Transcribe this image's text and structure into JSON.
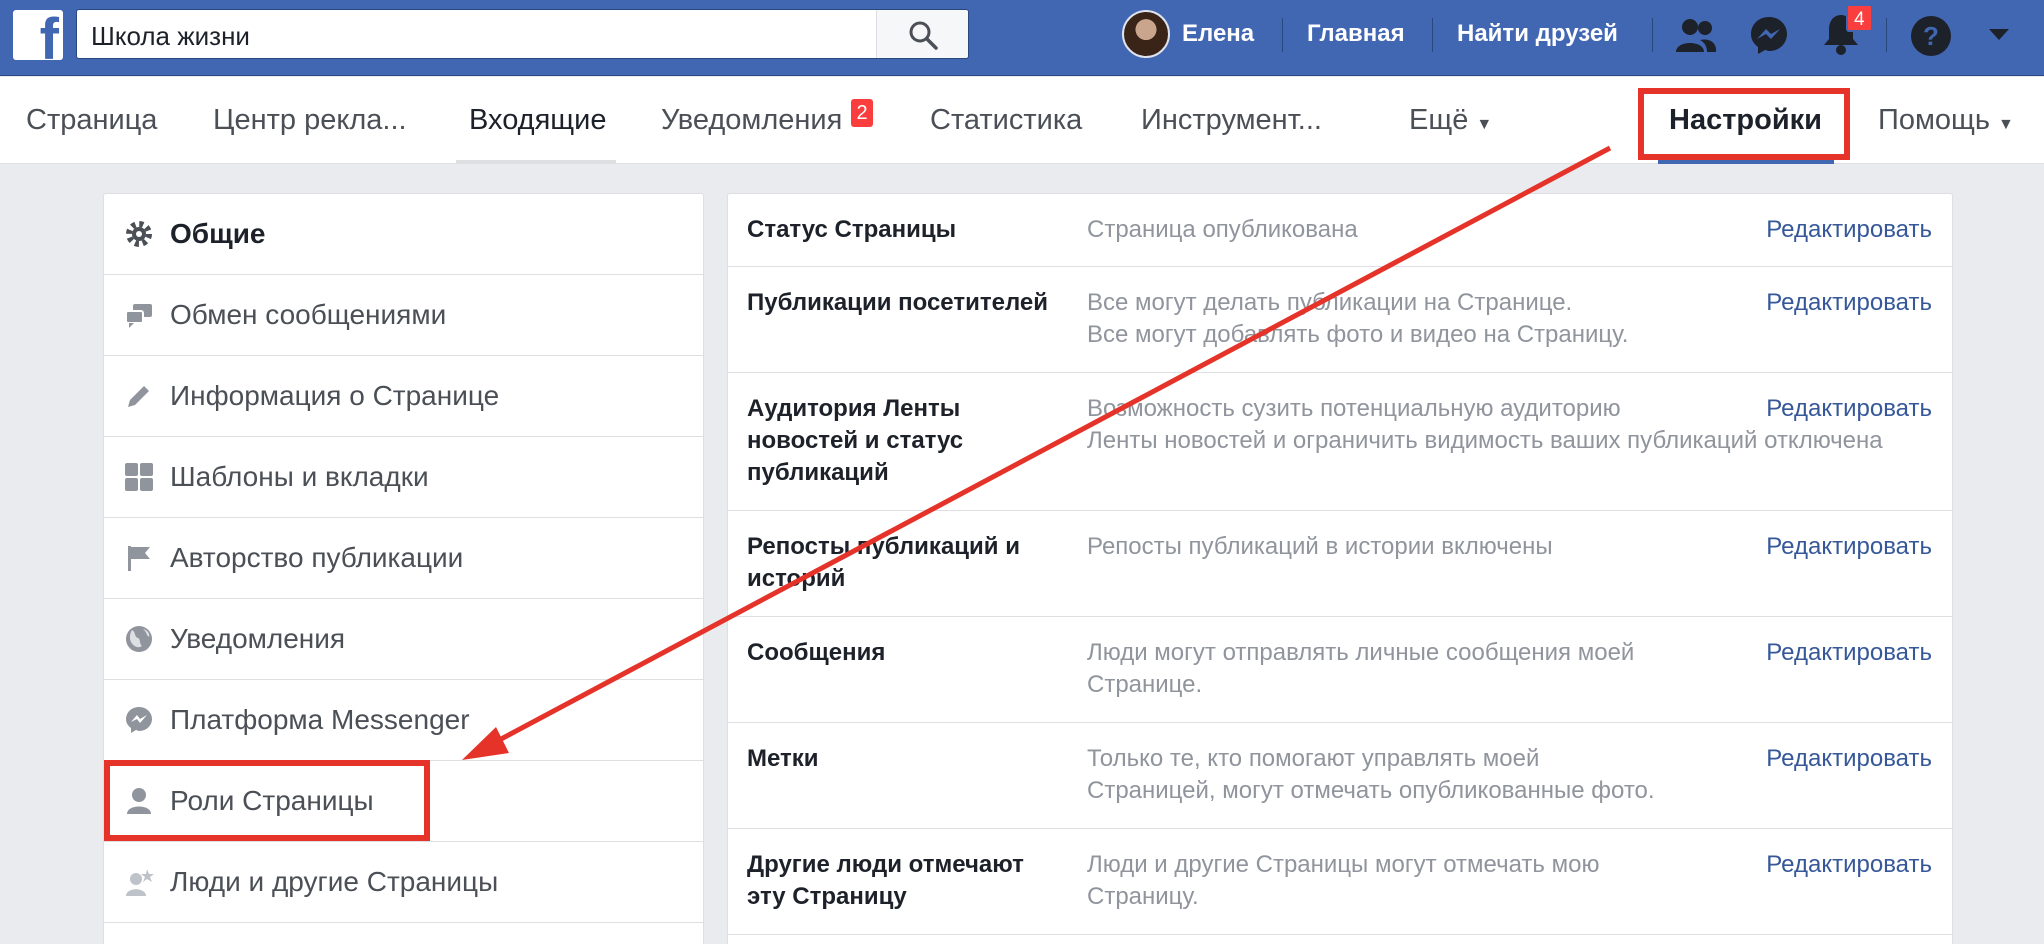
{
  "header": {
    "search_value": "Школа жизни",
    "user_name": "Елена",
    "home_label": "Главная",
    "find_friends_label": "Найти друзей",
    "notifications_count": "4",
    "icons": [
      "facebook-logo-icon",
      "search-icon",
      "friend-requests-icon",
      "messenger-icon",
      "notifications-bell-icon",
      "help-icon",
      "account-menu-caret-icon"
    ]
  },
  "page_nav": {
    "page": "Страница",
    "ad_center": "Центр рекла...",
    "inbox": "Входящие",
    "notifications": "Уведомления",
    "notifications_badge": "2",
    "insights": "Статистика",
    "tools": "Инструмент...",
    "more": "Ещё",
    "settings": "Настройки",
    "help": "Помощь",
    "active_tab": "Настройки"
  },
  "sidebar": {
    "items": [
      {
        "label": "Общие",
        "icon": "gear-icon",
        "active": true
      },
      {
        "label": "Обмен сообщениями",
        "icon": "chat-bubbles-icon"
      },
      {
        "label": "Информация о Странице",
        "icon": "pencil-icon"
      },
      {
        "label": "Шаблоны и вкладки",
        "icon": "grid-icon"
      },
      {
        "label": "Авторство публикации",
        "icon": "flag-icon"
      },
      {
        "label": "Уведомления",
        "icon": "globe-icon"
      },
      {
        "label": "Платформа Messenger",
        "icon": "messenger-icon"
      },
      {
        "label": "Роли Страницы",
        "icon": "person-icon"
      },
      {
        "label": "Люди и другие Страницы",
        "icon": "person-star-icon"
      }
    ]
  },
  "settings_rows": [
    {
      "title": "Статус Страницы",
      "value": "Страница опубликована",
      "edit": "Редактировать"
    },
    {
      "title": "Публикации посетителей",
      "value": "Все могут делать публикации на Странице.\nВсе могут добавлять фото и видео на Страницу.",
      "edit": "Редактировать"
    },
    {
      "title": "Аудитория Ленты новостей и статус публикаций",
      "value": "Возможность сузить потенциальную аудиторию\nЛенты новостей и ограничить видимость ваших публикаций отключена",
      "edit": "Редактировать"
    },
    {
      "title": "Репосты публикаций и историй",
      "value": "Репосты публикаций в истории включены",
      "edit": "Редактировать"
    },
    {
      "title": "Сообщения",
      "value": "Люди могут отправлять личные сообщения моей\nСтранице.",
      "edit": "Редактировать"
    },
    {
      "title": "Метки",
      "value": "Только те, кто помогают управлять моей\nСтраницей, могут отмечать опубликованные фото.",
      "edit": "Редактировать"
    },
    {
      "title": "Другие люди отмечают эту Страницу",
      "value": "Люди и другие Страницы могут отмечать мою\nСтраницу.",
      "edit": "Редактировать"
    }
  ],
  "annotation": {
    "highlight_color": "#e53329",
    "brand_color": "#4267b2",
    "link_color": "#365899"
  }
}
